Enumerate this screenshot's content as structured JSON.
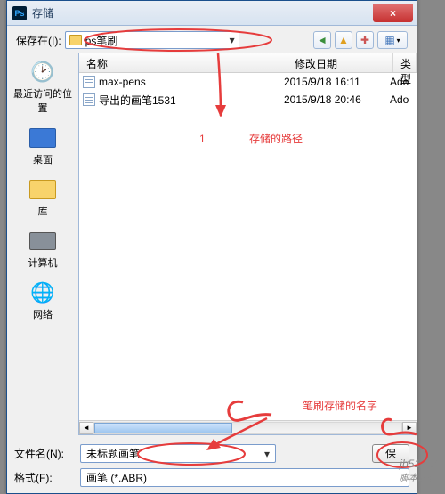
{
  "dialog": {
    "title": "存储",
    "close_symbol": "×"
  },
  "path_row": {
    "label": "保存在(I):",
    "value": "ps笔刷",
    "dropdown_arrow": "▾",
    "tool_icons": {
      "back": "◄",
      "up": "▲",
      "new_folder": "✚",
      "view": "▦",
      "view_arrow": "▾"
    }
  },
  "places": [
    {
      "label": "最近访问的位置",
      "emoji": "🕑"
    },
    {
      "label": "桌面",
      "emoji": "🖥"
    },
    {
      "label": "库",
      "emoji": "📚"
    },
    {
      "label": "计算机",
      "emoji": "💻"
    },
    {
      "label": "网络",
      "emoji": "🌐"
    }
  ],
  "columns": {
    "name": "名称",
    "date": "修改日期",
    "type": "类型"
  },
  "files": [
    {
      "name": "max-pens",
      "date": "2015/9/18 16:11",
      "type": "Ado"
    },
    {
      "name": "导出的画笔1531",
      "date": "2015/9/18 20:46",
      "type": "Ado"
    }
  ],
  "scrollbar": {
    "left": "◄",
    "right": "►"
  },
  "bottom": {
    "filename_label": "文件名(N):",
    "filename_value": "未标题画笔",
    "format_label": "格式(F):",
    "format_value": "画笔 (*.ABR)",
    "save_btn_visible": "保"
  },
  "annotations": {
    "a1": "存储的路径",
    "a2": "笔刷存储的名字"
  },
  "watermark": {
    "url": "jb51.net",
    "cn": "脚本之家"
  },
  "colors": {
    "anno": "#e63c3c"
  }
}
